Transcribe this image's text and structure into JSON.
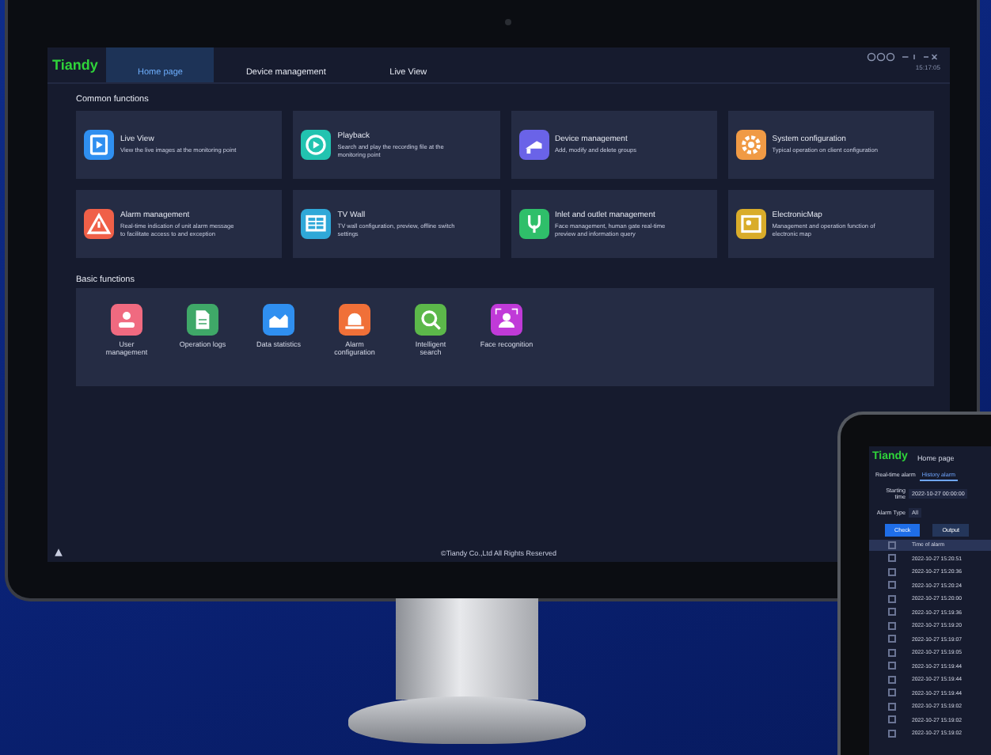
{
  "monitor": {
    "logo": "Tiandy",
    "tabs": [
      {
        "label": "Home page",
        "selected": true
      },
      {
        "label": "Device management",
        "selected": false
      },
      {
        "label": "Live View",
        "selected": false
      }
    ],
    "clock": "15:17:05",
    "common_title": "Common functions",
    "common": [
      {
        "title": "Live View",
        "desc": "View the live images at the monitoring point",
        "kind": "play",
        "color": "#2f8ff0"
      },
      {
        "title": "Playback",
        "desc": "Search and play the recording file at the monitoring point",
        "kind": "replay",
        "color": "#22c3b0"
      },
      {
        "title": "Device management",
        "desc": "Add, modify and delete groups",
        "kind": "camera",
        "color": "#6a63e8"
      },
      {
        "title": "System configuration",
        "desc": "Typical operation on client configuration",
        "kind": "gear",
        "color": "#f09a45"
      },
      {
        "title": "Alarm management",
        "desc": "Real-time indication of unit alarm message to facilitate access to and exception",
        "kind": "warning",
        "color": "#f06048"
      },
      {
        "title": "TV Wall",
        "desc": "TV wall configuration, preview, offline switch settings",
        "kind": "wall",
        "color": "#2fa8d8"
      },
      {
        "title": "Inlet and outlet management",
        "desc": "Face management, human gate real-time preview and information query",
        "kind": "person",
        "color": "#2fbf6a"
      },
      {
        "title": "ElectronicMap",
        "desc": "Management and operation function of electronic map",
        "kind": "map",
        "color": "#d9ac2a"
      }
    ],
    "basic_title": "Basic functions",
    "basic": [
      {
        "label": "User management",
        "kind": "user",
        "color": "#f06a80"
      },
      {
        "label": "Operation logs",
        "kind": "doc",
        "color": "#3fa868"
      },
      {
        "label": "Data statistics",
        "kind": "chart",
        "color": "#2f8ff0"
      },
      {
        "label": "Alarm configuration",
        "kind": "bell",
        "color": "#f07038"
      },
      {
        "label": "Intelligent search",
        "kind": "search",
        "color": "#5cb84a"
      },
      {
        "label": "Face recognition",
        "kind": "face",
        "color": "#c03ad8"
      }
    ],
    "footer": "©Tiandy Co.,Ltd All Rights Reserved"
  },
  "tablet": {
    "logo": "Tiandy",
    "page": "Home page",
    "tabs": [
      {
        "label": "Real-time alarm",
        "selected": false
      },
      {
        "label": "History alarm",
        "selected": true
      }
    ],
    "fields": [
      {
        "label": "Starting time",
        "value": "2022-10-27 00:00:00"
      },
      {
        "label": "Alarm Type",
        "value": "All"
      }
    ],
    "buttons": [
      {
        "label": "Check",
        "primary": true
      },
      {
        "label": "Output",
        "primary": false
      }
    ],
    "column": "Time of alarm",
    "all_checked": false,
    "rows": [
      {
        "time": "2022-10-27 15:20:51",
        "checked": false
      },
      {
        "time": "2022-10-27 15:20:36",
        "checked": false
      },
      {
        "time": "2022-10-27 15:20:24",
        "checked": false
      },
      {
        "time": "2022-10-27 15:20:00",
        "checked": false
      },
      {
        "time": "2022-10-27 15:19:36",
        "checked": false
      },
      {
        "time": "2022-10-27 15:19:20",
        "checked": false
      },
      {
        "time": "2022-10-27 15:19:07",
        "checked": false
      },
      {
        "time": "2022-10-27 15:19:05",
        "checked": false
      },
      {
        "time": "2022-10-27 15:19:44",
        "checked": false
      },
      {
        "time": "2022-10-27 15:19:44",
        "checked": false
      },
      {
        "time": "2022-10-27 15:19:44",
        "checked": false
      },
      {
        "time": "2022-10-27 15:19:02",
        "checked": false
      },
      {
        "time": "2022-10-27 15:19:02",
        "checked": false
      },
      {
        "time": "2022-10-27 15:19:02",
        "checked": false
      }
    ]
  }
}
